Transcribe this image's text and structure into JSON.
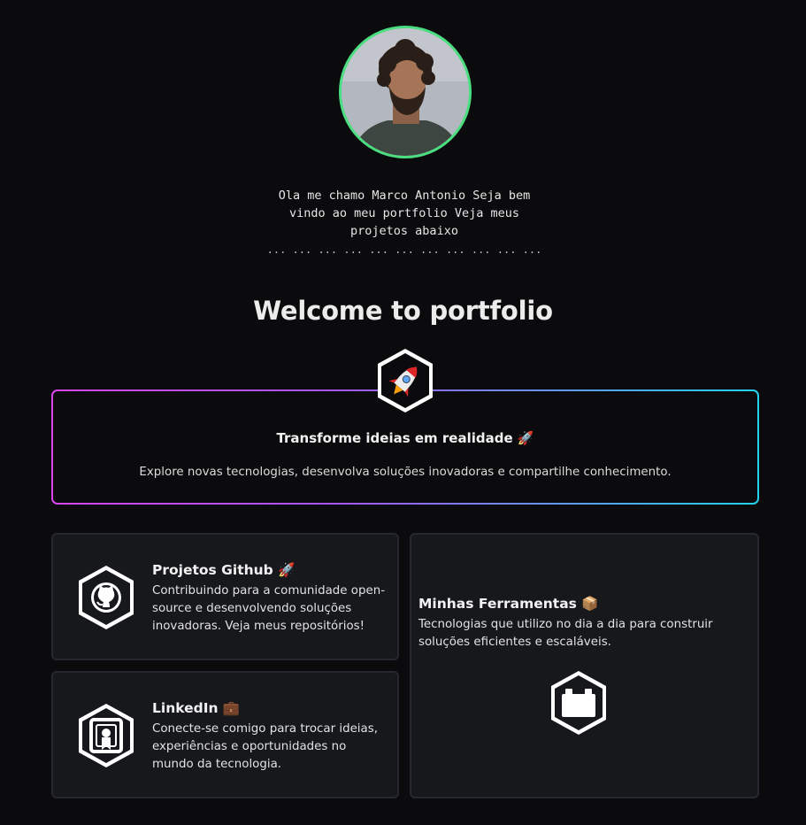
{
  "profile": {
    "intro_line1": "Ola me chamo Marco Antonio Seja bem",
    "intro_line2": "vindo ao meu portfolio Veja meus",
    "intro_line3": "projetos abaixo",
    "dots": "... ... ... ... ... ... ... ... ... ... ...",
    "avatar_icon": "profile-photo",
    "ring_color": "#4ade80"
  },
  "heading": "Welcome to portfolio",
  "hero": {
    "icon": "rocket-icon",
    "title": "Transforme ideias em realidade 🚀",
    "description": "Explore novas tecnologias, desenvolva soluções inovadoras e compartilhe conhecimento.",
    "gradient_start": "#d946ef",
    "gradient_end": "#22d3ee"
  },
  "cards": {
    "github": {
      "icon": "github-icon",
      "title": "Projetos Github 🚀",
      "line1": "Contribuindo para a comunidade open-",
      "line2": "source e desenvolvendo soluções",
      "line3": "inovadoras. Veja meus repositórios!"
    },
    "linkedin": {
      "icon": "linkedin-badge-icon",
      "title": "LinkedIn 💼",
      "line1": "Conecte-se comigo para trocar ideias,",
      "line2": "experiências e oportunidades no",
      "line3": "mundo da tecnologia."
    },
    "tools": {
      "icon": "toolbox-icon",
      "title": "Minhas Ferramentas 📦",
      "line1": "Tecnologias que utilizo no dia a dia para construir",
      "line2": "soluções eficientes e escaláveis."
    }
  }
}
